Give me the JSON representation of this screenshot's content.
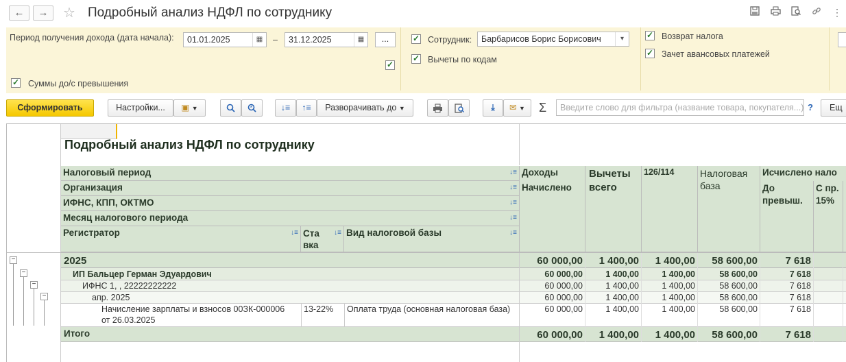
{
  "window": {
    "title": "Подробный анализ НДФЛ по сотруднику",
    "back_label": "←",
    "forward_label": "→",
    "icons": [
      "save-icon",
      "print-icon",
      "preview-icon",
      "link-icon",
      "more-icon"
    ]
  },
  "params": {
    "period_label": "Период получения дохода (дата начала):",
    "date_from": "01.01.2025",
    "date_dash": "–",
    "date_to": "31.12.2025",
    "period_more": "...",
    "employee_label": "Сотрудник:",
    "employee_value": "Барбарисов Борис Борисович",
    "deductions_by_codes_label": "Вычеты по кодам",
    "tax_refund_label": "Возврат налога",
    "advance_offset_label": "Зачет авансовых платежей",
    "sums_label": "Суммы до/с превышения"
  },
  "toolbar": {
    "generate_label": "Сформировать",
    "settings_label": "Настройки...",
    "expand_label": "Разворачивать до",
    "filter_placeholder": "Введите слово для фильтра (название товара, покупателя...)",
    "help_label": "?",
    "more_label": "Ещ"
  },
  "report": {
    "title": "Подробный анализ НДФЛ по сотруднику",
    "group_headers": [
      "Налоговый период",
      "Организация",
      "ИФНС, КПП, ОКТМО",
      "Месяц налогового периода"
    ],
    "registrator_header": "Регистратор",
    "rate_header": "Ста вка",
    "tax_base_kind_header": "Вид налоговой базы",
    "income_header": "Доходы",
    "accrued_header": "Начислено",
    "deductions_header": "Вычеты всего",
    "code_header": "126/114",
    "tax_base_header": "Налоговая база",
    "calculated_header": "Исчислено нало",
    "before_excess_header": "До превыш.",
    "with_15_header": "С пр. 15%",
    "rows": [
      {
        "label": "2025",
        "rate": "",
        "kind": "",
        "accrued": "60 000,00",
        "deductions": "1 400,00",
        "code": "1 400,00",
        "base": "58 600,00",
        "calc": "7 618"
      },
      {
        "label": "ИП Бальцер Герман Эдуардович",
        "rate": "",
        "kind": "",
        "accrued": "60 000,00",
        "deductions": "1 400,00",
        "code": "1 400,00",
        "base": "58 600,00",
        "calc": "7 618"
      },
      {
        "label": "ИФНС 1, , 22222222222",
        "rate": "",
        "kind": "",
        "accrued": "60 000,00",
        "deductions": "1 400,00",
        "code": "1 400,00",
        "base": "58 600,00",
        "calc": "7 618"
      },
      {
        "label": "апр. 2025",
        "rate": "",
        "kind": "",
        "accrued": "60 000,00",
        "deductions": "1 400,00",
        "code": "1 400,00",
        "base": "58 600,00",
        "calc": "7 618"
      },
      {
        "label": "Начисление зарплаты и взносов 00ЗК-000006",
        "label2": "от 26.03.2025",
        "rate": "13-22%",
        "kind": "Оплата труда (основная налоговая база)",
        "accrued": "60 000,00",
        "deductions": "1 400,00",
        "code": "1 400,00",
        "base": "58 600,00",
        "calc": "7 618"
      }
    ],
    "total": {
      "label": "Итого",
      "accrued": "60 000,00",
      "deductions": "1 400,00",
      "code": "1 400,00",
      "base": "58 600,00",
      "calc": "7 618"
    }
  }
}
